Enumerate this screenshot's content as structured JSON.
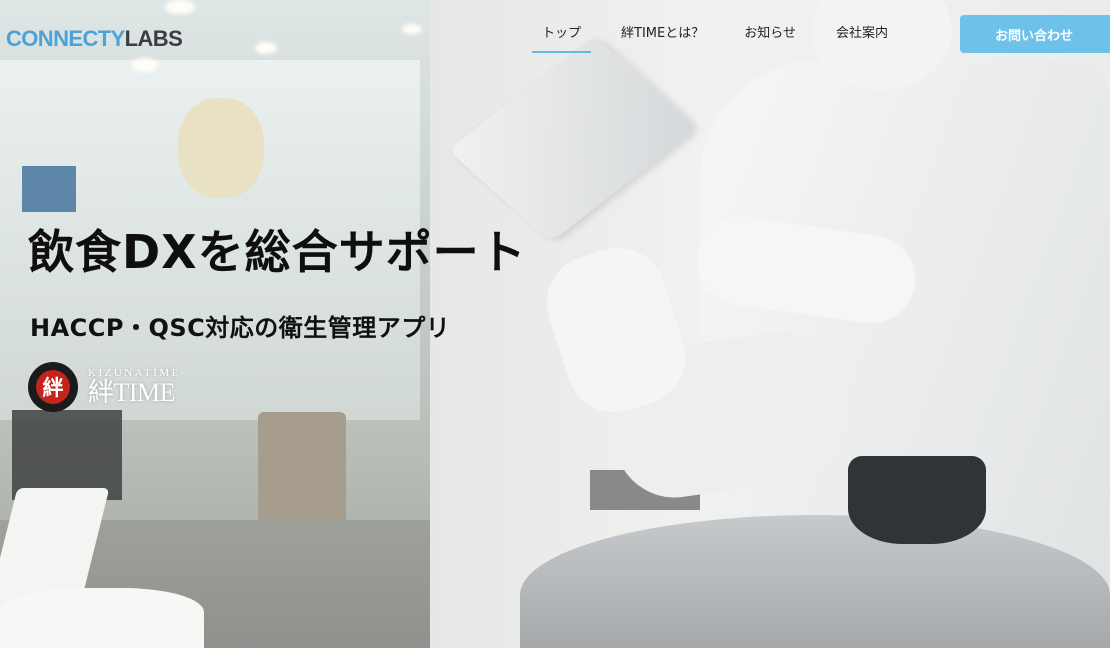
{
  "logo": {
    "part1": "CONNECTY",
    "part2": "LABS",
    "accent": "#4da3d8"
  },
  "nav": {
    "items": [
      {
        "label": "トップ",
        "active": true
      },
      {
        "label": "絆TIMEとは？",
        "active": false
      },
      {
        "label": "お知らせ",
        "active": false
      },
      {
        "label": "会社案内",
        "active": false
      }
    ],
    "cta_label": "お問い合わせ",
    "cta_color": "#6ec2ea"
  },
  "hero": {
    "headline": "飲食DXを総合サポート",
    "subheadline": "HACCP・QSC対応の衛生管理アプリ",
    "brand": {
      "seal_char": "絆",
      "tagline": "KIZUNATIME",
      "name": "絆TIME"
    }
  }
}
